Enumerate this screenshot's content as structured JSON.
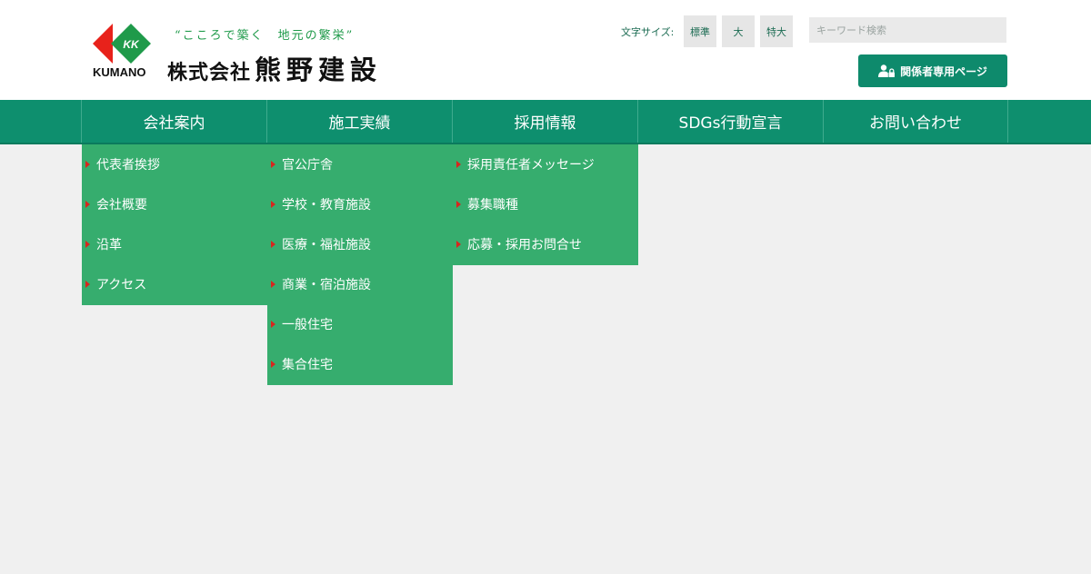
{
  "logo": {
    "kumano": "KUMANO",
    "mark_text": "KK",
    "slogan": "“こころで築く　地元の繁栄”",
    "company_type": "株式会社",
    "company_name": "熊野建設",
    "colors": {
      "red": "#e8221b",
      "green": "#1f9a4a"
    }
  },
  "header": {
    "font_size_label": "文字サイズ:",
    "font_sizes": [
      "標準",
      "大",
      "特大"
    ],
    "search_placeholder": "キーワード検索",
    "member_button": "関係者専用ページ",
    "member_icon": "user-lock-icon"
  },
  "nav": {
    "items": [
      "会社案内",
      "施工実績",
      "採用情報",
      "SDGs行動宣言",
      "お問い合わせ"
    ]
  },
  "dropdowns": {
    "company": [
      "代表者挨拶",
      "会社概要",
      "沿革",
      "アクセス"
    ],
    "works": [
      "官公庁舎",
      "学校・教育施設",
      "医療・福祉施設",
      "商業・宿泊施設",
      "一般住宅",
      "集合住宅"
    ],
    "recruit": [
      "採用責任者メッセージ",
      "募集職種",
      "応募・採用お問合せ"
    ]
  },
  "colors": {
    "nav_bg": "#0e8f6e",
    "dropdown_bg": "#36ad6e",
    "accent": "#0e8a6c",
    "bullet": "#d7261e",
    "page_bg": "#f0f0f0"
  }
}
